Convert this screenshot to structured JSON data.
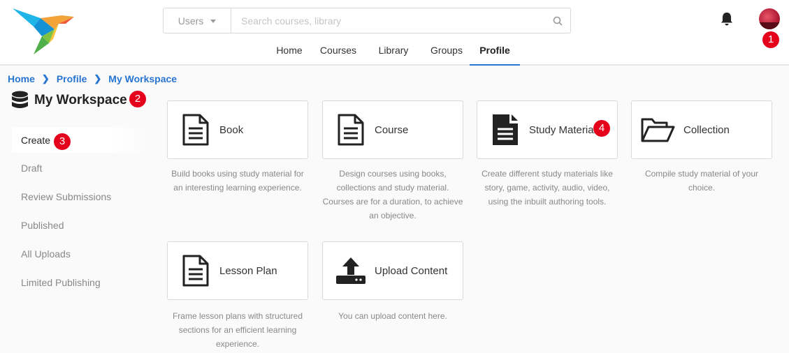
{
  "header": {
    "search": {
      "scope_label": "Users",
      "placeholder": "Search courses, library"
    },
    "nav": [
      "Home",
      "Courses",
      "Library",
      "Groups",
      "Profile"
    ],
    "active_nav": "Profile"
  },
  "badges": [
    "1",
    "2",
    "3",
    "4"
  ],
  "breadcrumb": [
    "Home",
    "Profile",
    "My Workspace"
  ],
  "workspace_title": "My Workspace",
  "sidebar": {
    "items": [
      "Create",
      "Draft",
      "Review Submissions",
      "Published",
      "All Uploads",
      "Limited Publishing"
    ],
    "active": "Create"
  },
  "cards": [
    {
      "label": "Book",
      "icon": "document-outline-icon",
      "description": "Build books using study material for an interesting learning experience."
    },
    {
      "label": "Course",
      "icon": "document-outline-icon",
      "description": "Design courses using books, collections and study material. Courses are for a duration, to achieve an objective."
    },
    {
      "label": "Study Material",
      "icon": "document-filled-icon",
      "description": "Create different study materials like story, game, activity, audio, video, using the inbuilt authoring tools."
    },
    {
      "label": "Collection",
      "icon": "folder-open-icon",
      "description": "Compile study material of your choice."
    },
    {
      "label": "Lesson Plan",
      "icon": "document-outline-icon",
      "description": "Frame lesson plans with structured sections for an efficient learning experience."
    },
    {
      "label": "Upload Content",
      "icon": "upload-icon",
      "description": "You can upload content here."
    }
  ],
  "colors": {
    "accent": "#2875d1",
    "badge": "#e5001c"
  }
}
